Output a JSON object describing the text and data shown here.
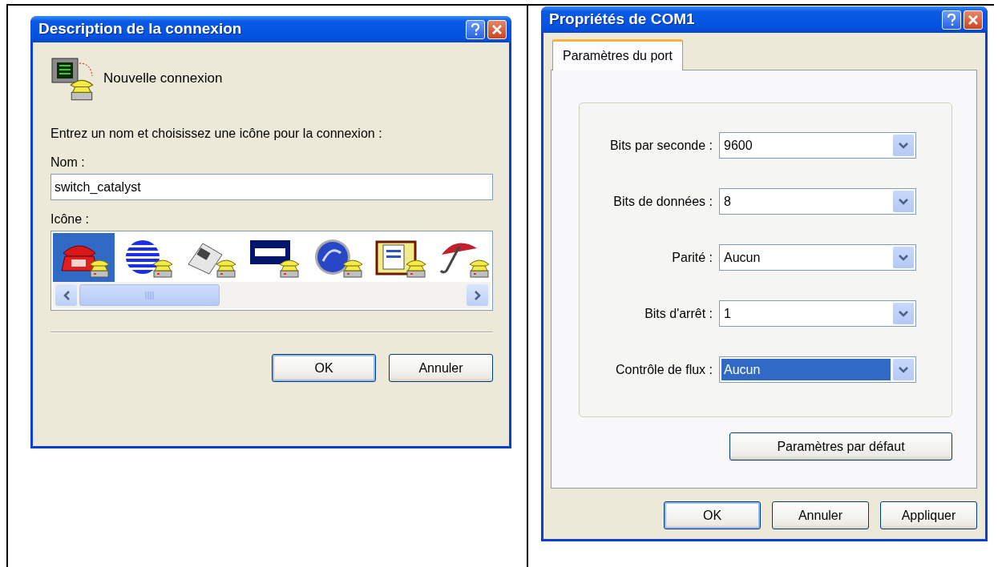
{
  "dialogs": [
    {
      "title": "Description de la connexion",
      "heading": "Nouvelle connexion",
      "prompt": "Entrez un nom et choisissez une icône pour la connexion :",
      "name_label": "Nom :",
      "name_value": "switch_catalyst",
      "icons_label": "Icône :",
      "icons": [
        {
          "selected": true
        },
        {
          "selected": false
        },
        {
          "selected": false
        },
        {
          "selected": false
        },
        {
          "selected": false
        },
        {
          "selected": false
        },
        {
          "selected": false
        }
      ],
      "buttons": [
        {
          "label": "OK",
          "default": true
        },
        {
          "label": "Annuler",
          "default": false
        }
      ]
    },
    {
      "title": "Propriétés de COM1",
      "tabs": [
        {
          "label": "Paramètres du port",
          "selected": true
        }
      ],
      "fields": [
        {
          "label": "Bits par seconde :",
          "value": "9600",
          "focused": false
        },
        {
          "label": "Bits de données :",
          "value": "8",
          "focused": false
        },
        {
          "label": "Parité :",
          "value": "Aucun",
          "focused": false
        },
        {
          "label": "Bits d'arrêt :",
          "value": "1",
          "focused": false
        },
        {
          "label": "Contrôle de flux :",
          "value": "Aucun",
          "focused": true
        }
      ],
      "defaults_button": "Paramètres par défaut",
      "buttons": [
        {
          "label": "OK",
          "default": true
        },
        {
          "label": "Annuler",
          "default": false
        },
        {
          "label": "Appliquer",
          "default": false
        }
      ]
    }
  ]
}
